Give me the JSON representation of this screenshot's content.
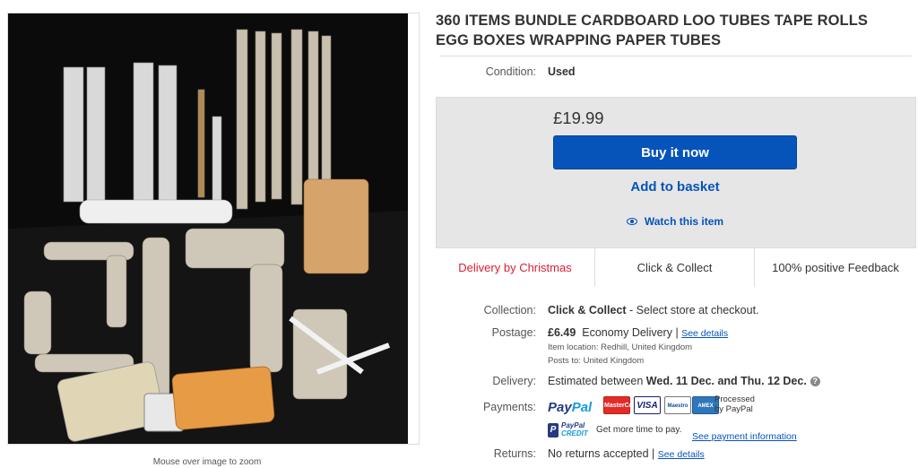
{
  "image": {
    "zoom_hint": "Mouse over image to zoom"
  },
  "listing": {
    "title_line1": "360 ITEMS BUNDLE CARDBOARD LOO TUBES TAPE ROLLS",
    "title_line2": "EGG BOXES WRAPPING PAPER TUBES"
  },
  "condition": {
    "label": "Condition:",
    "value": "Used"
  },
  "buy": {
    "price": "£19.99",
    "buy_now": "Buy it now",
    "add_basket": "Add to basket",
    "watch": "Watch this item",
    "perks": [
      "Delivery by Christmas",
      "Click & Collect",
      "100% positive Feedback"
    ],
    "colors": {
      "primary": "#0654ba",
      "christmas": "#dd1e31",
      "panel": "#e6e6e6"
    }
  },
  "collection": {
    "label": "Collection:",
    "value_bold": "Click & Collect",
    "value_rest": " - Select store at checkout."
  },
  "postage": {
    "label": "Postage:",
    "price": "£6.49",
    "service": "Economy Delivery",
    "sep": "|",
    "details_link": "See details",
    "location": "Item location:  Redhill, United Kingdom",
    "posts_to": "Posts to:  United Kingdom"
  },
  "delivery": {
    "label": "Delivery:",
    "prefix": "Estimated between ",
    "range": "Wed. 11 Dec. and Thu. 12 Dec.",
    "help_icon": "?"
  },
  "payments": {
    "label": "Payments:",
    "paypal_a": "Pay",
    "paypal_b": "Pal",
    "cards": [
      "MasterCard",
      "VISA",
      "Maestro",
      "AMEX"
    ],
    "processed_1": "Processed",
    "processed_2": "by PayPal",
    "credit_a": "PayPal",
    "credit_b": "CREDIT",
    "credit_mark": "P",
    "credit_text": "Get more time to pay.",
    "credit_link": "See payment information"
  },
  "returns": {
    "label": "Returns:",
    "value": "No returns accepted",
    "sep": "|",
    "link": "See details"
  }
}
